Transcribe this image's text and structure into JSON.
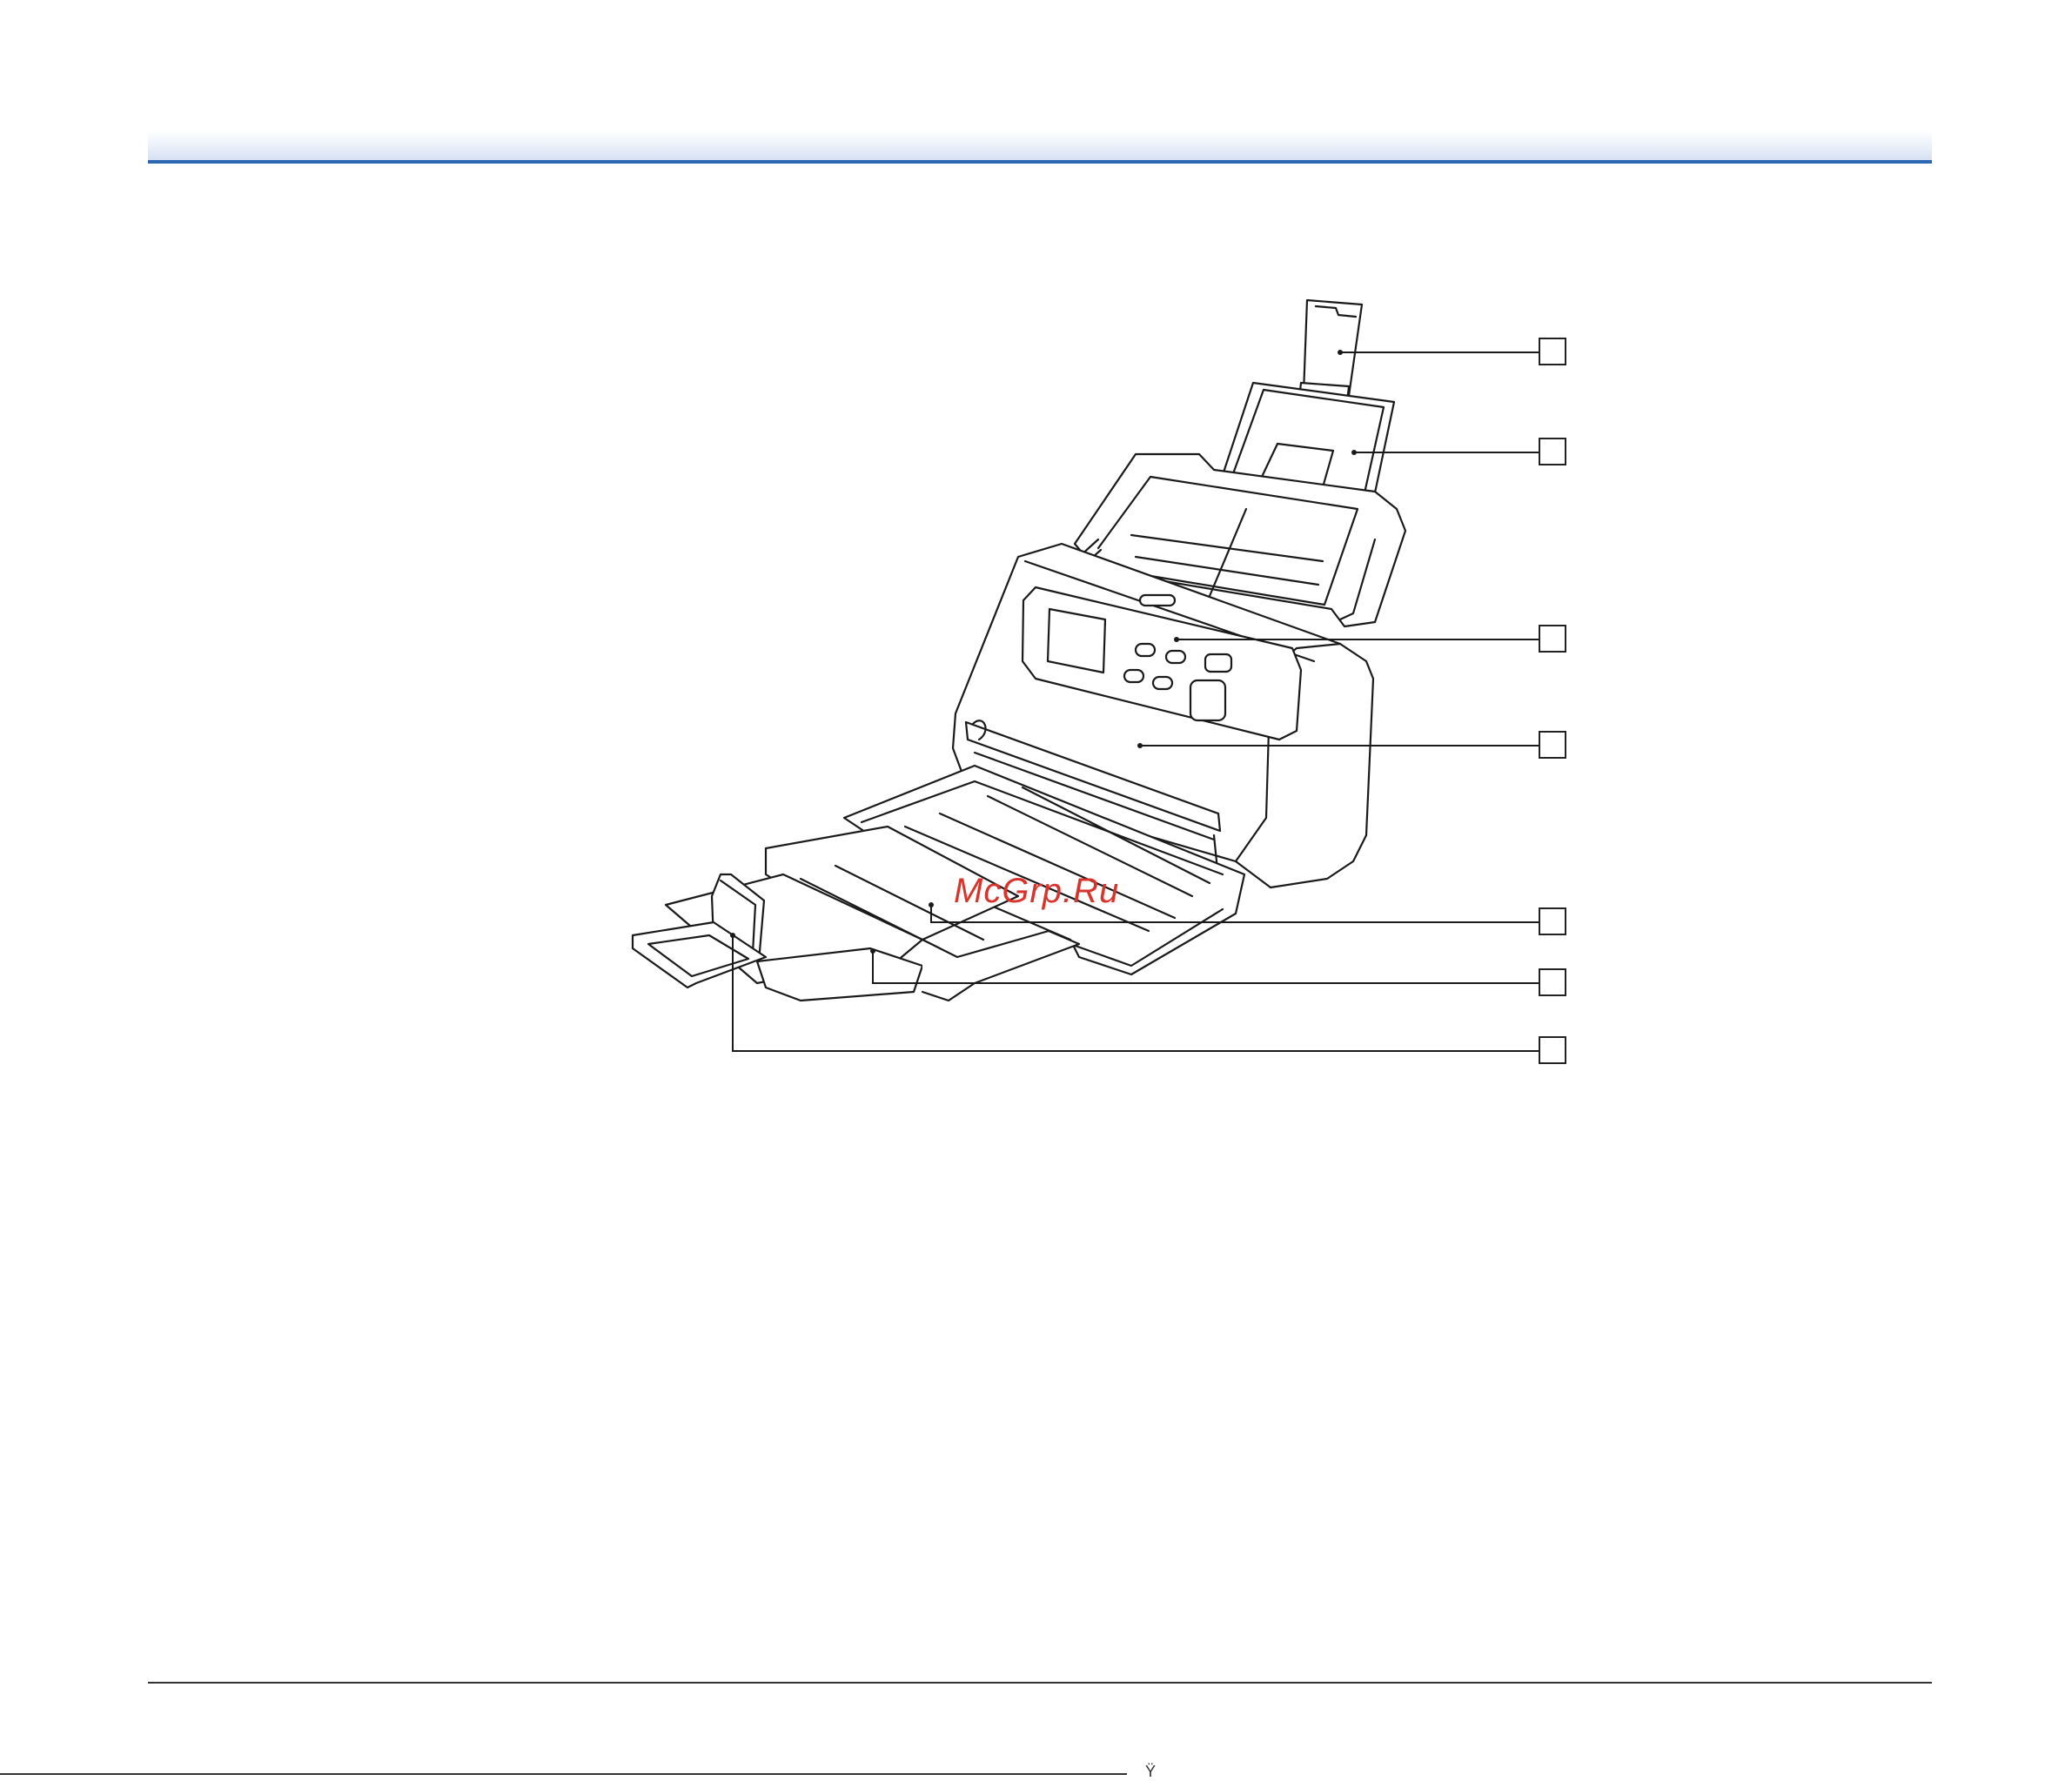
{
  "watermark": "McGrp.Ru",
  "bottom_mark": "Ÿ",
  "colors": {
    "header_rule": "#2c67b4",
    "header_gradient": "#d3def2",
    "watermark": "#d8342c"
  },
  "callouts": [
    {
      "id": "callout-1",
      "part": "document-feed-extension-support",
      "label": ""
    },
    {
      "id": "callout-2",
      "part": "document-feed-tray",
      "label": ""
    },
    {
      "id": "callout-3",
      "part": "operation-panel",
      "label": ""
    },
    {
      "id": "callout-4",
      "part": "front-unit",
      "label": ""
    },
    {
      "id": "callout-5",
      "part": "eject-tray",
      "label": ""
    },
    {
      "id": "callout-6",
      "part": "eject-tray-extension",
      "label": ""
    },
    {
      "id": "callout-7",
      "part": "document-stopper",
      "label": ""
    }
  ]
}
